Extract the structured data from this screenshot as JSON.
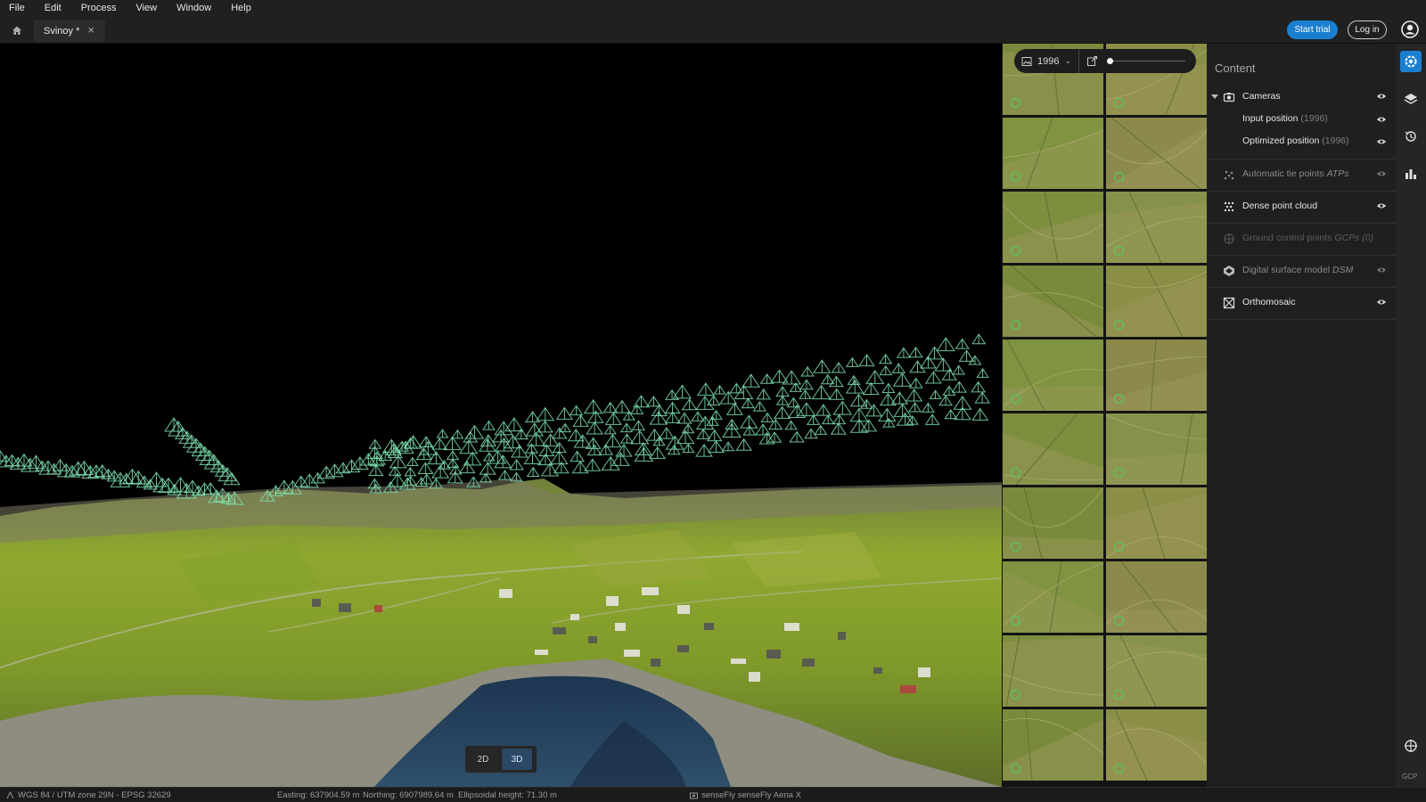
{
  "menu": [
    "File",
    "Edit",
    "Process",
    "View",
    "Window",
    "Help"
  ],
  "tab": {
    "label": "Svinoy *"
  },
  "header": {
    "start_trial": "Start trial",
    "login": "Log in"
  },
  "viewport": {
    "mode_2d": "2D",
    "mode_3d": "3D",
    "active_mode": "3D"
  },
  "thumbnails": {
    "count_label": "1996",
    "slider_level": 0.0,
    "visible_rows": 10
  },
  "content": {
    "title": "Content",
    "cameras": {
      "label": "Cameras",
      "input": {
        "label": "Input position",
        "count": "(1996)"
      },
      "optimized": {
        "label": "Optimized position",
        "count": "(1996)"
      }
    },
    "layers": [
      {
        "label": "Automatic tie points",
        "abbr": "ATPs",
        "state": "dim"
      },
      {
        "label": "Dense point cloud",
        "abbr": "",
        "state": "on"
      },
      {
        "label": "Ground control points",
        "abbr": "GCPs (0)",
        "state": "off"
      },
      {
        "label": "Digital surface model",
        "abbr": "DSM",
        "state": "dim"
      },
      {
        "label": "Orthomosaic",
        "abbr": "",
        "state": "on"
      }
    ]
  },
  "rail": {
    "gcp_label": "GCP"
  },
  "status": {
    "crs": "WGS 84 / UTM zone 29N - EPSG 32629",
    "easting": "Easting: 637904.59 m",
    "northing": "Northing: 6907989.64 m",
    "height": "Ellipsoidal height: 71.30 m",
    "camera": "senseFly senseFly Aeria X"
  },
  "colors": {
    "accent": "#1b7fd1",
    "check": "#4ccf6a",
    "camera_frustum": "#7fe0b0"
  }
}
